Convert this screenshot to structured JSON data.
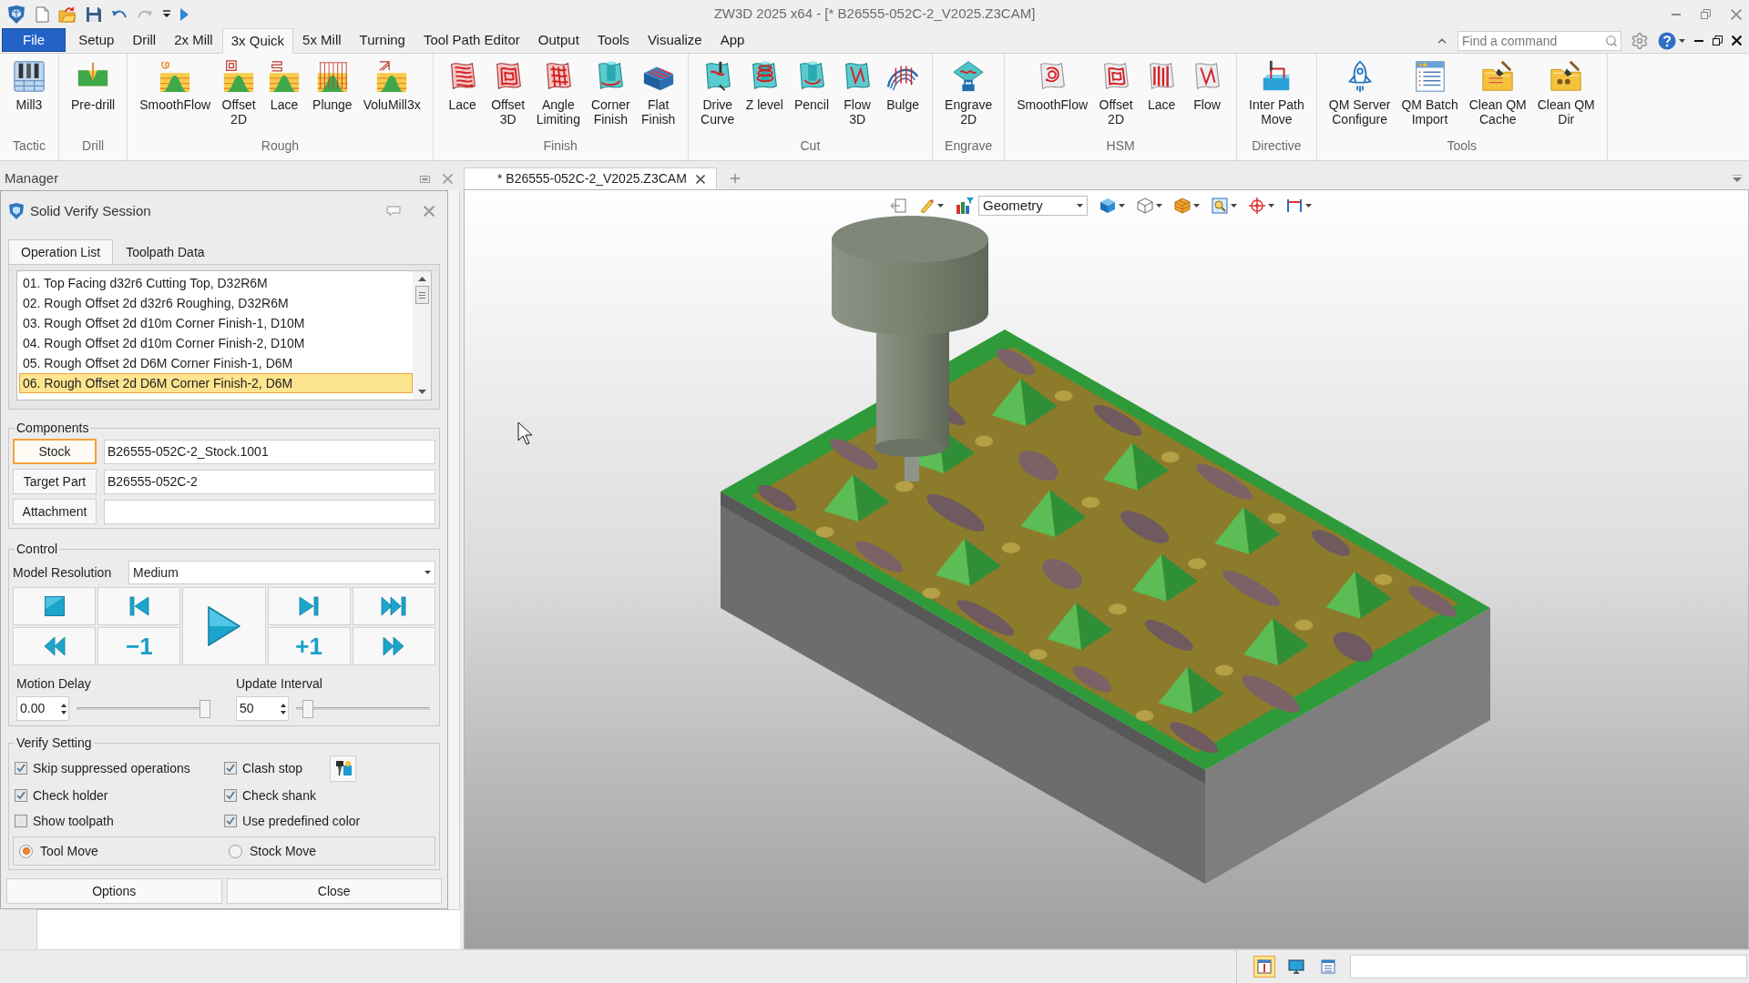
{
  "title_bar": {
    "quick_access": [
      {
        "disabled": false
      },
      {
        "disabled": false
      },
      {
        "disabled": false
      },
      {
        "disabled": false
      },
      {
        "disabled": true
      },
      {
        "disabled": false
      },
      {
        "disabled": false
      }
    ],
    "title": "ZW3D 2025 x64 - [* B26555-052C-2_V2025.Z3CAM]"
  },
  "ribbon": {
    "tabs": [
      {
        "label": "File",
        "kind": "file",
        "selected": false
      },
      {
        "label": "Setup",
        "kind": "tab",
        "selected": false
      },
      {
        "label": "Drill",
        "kind": "tab",
        "selected": false
      },
      {
        "label": "2x Mill",
        "kind": "tab",
        "selected": false
      },
      {
        "label": "3x Quick",
        "kind": "tab",
        "selected": true
      },
      {
        "label": "5x Mill",
        "kind": "tab",
        "selected": false
      },
      {
        "label": "Turning",
        "kind": "tab",
        "selected": false
      },
      {
        "label": "Tool Path Editor",
        "kind": "tab",
        "selected": false
      },
      {
        "label": "Output",
        "kind": "tab",
        "selected": false
      },
      {
        "label": "Tools",
        "kind": "tab",
        "selected": false
      },
      {
        "label": "Visualize",
        "kind": "tab",
        "selected": false
      },
      {
        "label": "App",
        "kind": "tab",
        "selected": false
      }
    ],
    "search": {
      "placeholder": "Find a command"
    },
    "groups": [
      {
        "label": "Tactic",
        "buttons": [
          {
            "label": "Mill3"
          }
        ]
      },
      {
        "label": "Drill",
        "buttons": [
          {
            "label": "Pre-drill"
          }
        ]
      },
      {
        "label": "Rough",
        "buttons": [
          {
            "label": "SmoothFlow"
          },
          {
            "label": "Offset\n2D"
          },
          {
            "label": "Lace"
          },
          {
            "label": "Plunge"
          },
          {
            "label": "VoluMill3x"
          }
        ]
      },
      {
        "label": "Finish",
        "buttons": [
          {
            "label": "Lace"
          },
          {
            "label": "Offset\n3D"
          },
          {
            "label": "Angle\nLimiting"
          },
          {
            "label": "Corner\nFinish"
          },
          {
            "label": "Flat\nFinish"
          }
        ]
      },
      {
        "label": "Cut",
        "buttons": [
          {
            "label": "Drive\nCurve"
          },
          {
            "label": "Z level"
          },
          {
            "label": "Pencil"
          },
          {
            "label": "Flow\n3D"
          },
          {
            "label": "Bulge"
          }
        ]
      },
      {
        "label": "Engrave",
        "buttons": [
          {
            "label": "Engrave\n2D"
          }
        ]
      },
      {
        "label": "HSM",
        "buttons": [
          {
            "label": "SmoothFlow"
          },
          {
            "label": "Offset\n2D"
          },
          {
            "label": "Lace"
          },
          {
            "label": "Flow"
          }
        ]
      },
      {
        "label": "Directive",
        "buttons": [
          {
            "label": "Inter Path\nMove"
          }
        ]
      },
      {
        "label": "Tools",
        "buttons": [
          {
            "label": "QM Server\nConfigure"
          },
          {
            "label": "QM Batch\nImport"
          },
          {
            "label": "Clean QM\nCache"
          },
          {
            "label": "Clean QM\nDir"
          }
        ]
      }
    ]
  },
  "manager": {
    "title": "Manager"
  },
  "dialog": {
    "title": "Solid Verify Session",
    "tabs": [
      {
        "label": "Operation List",
        "selected": true
      },
      {
        "label": "Toolpath Data",
        "selected": false
      }
    ],
    "operations": [
      {
        "label": "01. Top Facing d32r6 Cutting Top, D32R6M",
        "selected": false
      },
      {
        "label": "02. Rough Offset 2d d32r6 Roughing, D32R6M",
        "selected": false
      },
      {
        "label": "03. Rough Offset 2d d10m Corner Finish-1, D10M",
        "selected": false
      },
      {
        "label": "04. Rough Offset 2d d10m Corner Finish-2, D10M",
        "selected": false
      },
      {
        "label": "05. Rough Offset 2d D6M Corner Finish-1, D6M",
        "selected": false
      },
      {
        "label": "06. Rough Offset 2d D6M Corner Finish-2, D6M",
        "selected": true
      }
    ],
    "components": {
      "title": "Components",
      "rows": [
        {
          "button": "Stock",
          "selected": true,
          "value": "B26555-052C-2_Stock.1001"
        },
        {
          "button": "Target Part",
          "selected": false,
          "value": "B26555-052C-2"
        },
        {
          "button": "Attachment",
          "selected": false
        }
      ]
    },
    "control": {
      "title": "Control",
      "resolution_label": "Model Resolution",
      "resolution": "Medium",
      "playback": [
        {
          "kind": "stop"
        },
        {
          "kind": "first"
        },
        {
          "kind": "play"
        },
        {
          "kind": "next"
        },
        {
          "kind": "last"
        },
        {
          "kind": "rewind"
        },
        {
          "kind": "step",
          "label": "−1"
        },
        {
          "kind": "step",
          "label": "+1"
        },
        {
          "kind": "fast_forward"
        }
      ],
      "motion_delay": {
        "label": "Motion Delay",
        "value": "0.00",
        "level": 0.96
      },
      "update_interval": {
        "label": "Update Interval",
        "value": "50",
        "level": 0.09
      }
    },
    "verify_setting": {
      "title": "Verify Setting",
      "options": [
        {
          "label": "Skip suppressed operations",
          "checked": true
        },
        {
          "label": "Clash stop",
          "checked": true
        },
        {
          "label": "Check holder",
          "checked": true
        },
        {
          "label": "Check shank",
          "checked": true
        },
        {
          "label": "Show toolpath",
          "checked": false
        },
        {
          "label": "Use predefined color",
          "checked": true
        }
      ],
      "move_modes": [
        {
          "label": "Tool Move",
          "selected": true
        },
        {
          "label": "Stock Move",
          "selected": false
        }
      ]
    },
    "buttons": [
      "Options",
      "Close"
    ]
  },
  "document_tabs": [
    {
      "label": "* B26555-052C-2_V2025.Z3CAM",
      "selected": true
    }
  ],
  "viewport": {
    "display_mode": "Geometry"
  },
  "status_bar": {
    "views": [
      {
        "selected": true
      },
      {
        "selected": false
      },
      {
        "selected": false
      }
    ]
  }
}
